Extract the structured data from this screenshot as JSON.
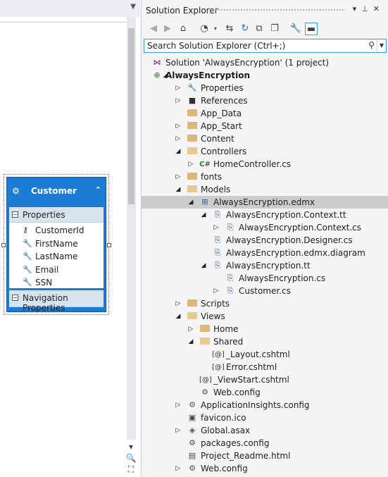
{
  "designer": {
    "entity": {
      "title": "Customer",
      "properties_label": "Properties",
      "properties": [
        "CustomerId",
        "FirstName",
        "LastName",
        "Email",
        "SSN"
      ],
      "navigation_label": "Navigation Properties"
    }
  },
  "solution_explorer": {
    "title": "Solution Explorer",
    "search_placeholder": "Search Solution Explorer (Ctrl+;)",
    "tree": [
      {
        "label": "Solution 'AlwaysEncryption' (1 project)",
        "depth": 0,
        "arrow": "",
        "icon": "vs-solution-icon",
        "bold": false
      },
      {
        "label": "AlwaysEncryption",
        "depth": 0,
        "arrow": "down",
        "icon": "web-project-icon",
        "bold": true
      },
      {
        "label": "Properties",
        "depth": 1,
        "arrow": "right",
        "icon": "wrench-icon"
      },
      {
        "label": "References",
        "depth": 1,
        "arrow": "right",
        "icon": "references-icon"
      },
      {
        "label": "App_Data",
        "depth": 1,
        "arrow": "",
        "icon": "folder-icon"
      },
      {
        "label": "App_Start",
        "depth": 1,
        "arrow": "right",
        "icon": "folder-icon"
      },
      {
        "label": "Content",
        "depth": 1,
        "arrow": "right",
        "icon": "folder-icon"
      },
      {
        "label": "Controllers",
        "depth": 1,
        "arrow": "down",
        "icon": "folder-open-icon"
      },
      {
        "label": "HomeController.cs",
        "depth": 2,
        "arrow": "right",
        "icon": "csharp-icon"
      },
      {
        "label": "fonts",
        "depth": 1,
        "arrow": "right",
        "icon": "folder-icon"
      },
      {
        "label": "Models",
        "depth": 1,
        "arrow": "down",
        "icon": "folder-open-icon"
      },
      {
        "label": "AlwaysEncryption.edmx",
        "depth": 2,
        "arrow": "down",
        "icon": "edmx-icon",
        "selected": true
      },
      {
        "label": "AlwaysEncryption.Context.tt",
        "depth": 3,
        "arrow": "down",
        "icon": "tt-file-icon"
      },
      {
        "label": "AlwaysEncryption.Context.cs",
        "depth": 4,
        "arrow": "right",
        "icon": "tt-file-icon"
      },
      {
        "label": "AlwaysEncryption.Designer.cs",
        "depth": 3,
        "arrow": "",
        "icon": "tt-file-icon"
      },
      {
        "label": "AlwaysEncryption.edmx.diagram",
        "depth": 3,
        "arrow": "",
        "icon": "tt-file-icon"
      },
      {
        "label": "AlwaysEncryption.tt",
        "depth": 3,
        "arrow": "down",
        "icon": "tt-file-icon"
      },
      {
        "label": "AlwaysEncryption.cs",
        "depth": 4,
        "arrow": "",
        "icon": "tt-file-icon"
      },
      {
        "label": "Customer.cs",
        "depth": 4,
        "arrow": "right",
        "icon": "tt-file-icon"
      },
      {
        "label": "Scripts",
        "depth": 1,
        "arrow": "right",
        "icon": "folder-icon"
      },
      {
        "label": "Views",
        "depth": 1,
        "arrow": "down",
        "icon": "folder-open-icon"
      },
      {
        "label": "Home",
        "depth": 2,
        "arrow": "right",
        "icon": "folder-icon"
      },
      {
        "label": "Shared",
        "depth": 2,
        "arrow": "down",
        "icon": "folder-open-icon"
      },
      {
        "label": "_Layout.cshtml",
        "depth": 3,
        "arrow": "",
        "icon": "razor-icon"
      },
      {
        "label": "Error.cshtml",
        "depth": 3,
        "arrow": "",
        "icon": "razor-icon"
      },
      {
        "label": "_ViewStart.cshtml",
        "depth": 2,
        "arrow": "",
        "icon": "razor-icon"
      },
      {
        "label": "Web.config",
        "depth": 2,
        "arrow": "",
        "icon": "config-icon"
      },
      {
        "label": "ApplicationInsights.config",
        "depth": 1,
        "arrow": "right",
        "icon": "config-icon"
      },
      {
        "label": "favicon.ico",
        "depth": 1,
        "arrow": "",
        "icon": "ico-file-icon"
      },
      {
        "label": "Global.asax",
        "depth": 1,
        "arrow": "right",
        "icon": "asax-icon"
      },
      {
        "label": "packages.config",
        "depth": 1,
        "arrow": "",
        "icon": "config-icon"
      },
      {
        "label": "Project_Readme.html",
        "depth": 1,
        "arrow": "",
        "icon": "html-file-icon"
      },
      {
        "label": "Web.config",
        "depth": 1,
        "arrow": "right",
        "icon": "config-icon"
      }
    ]
  }
}
